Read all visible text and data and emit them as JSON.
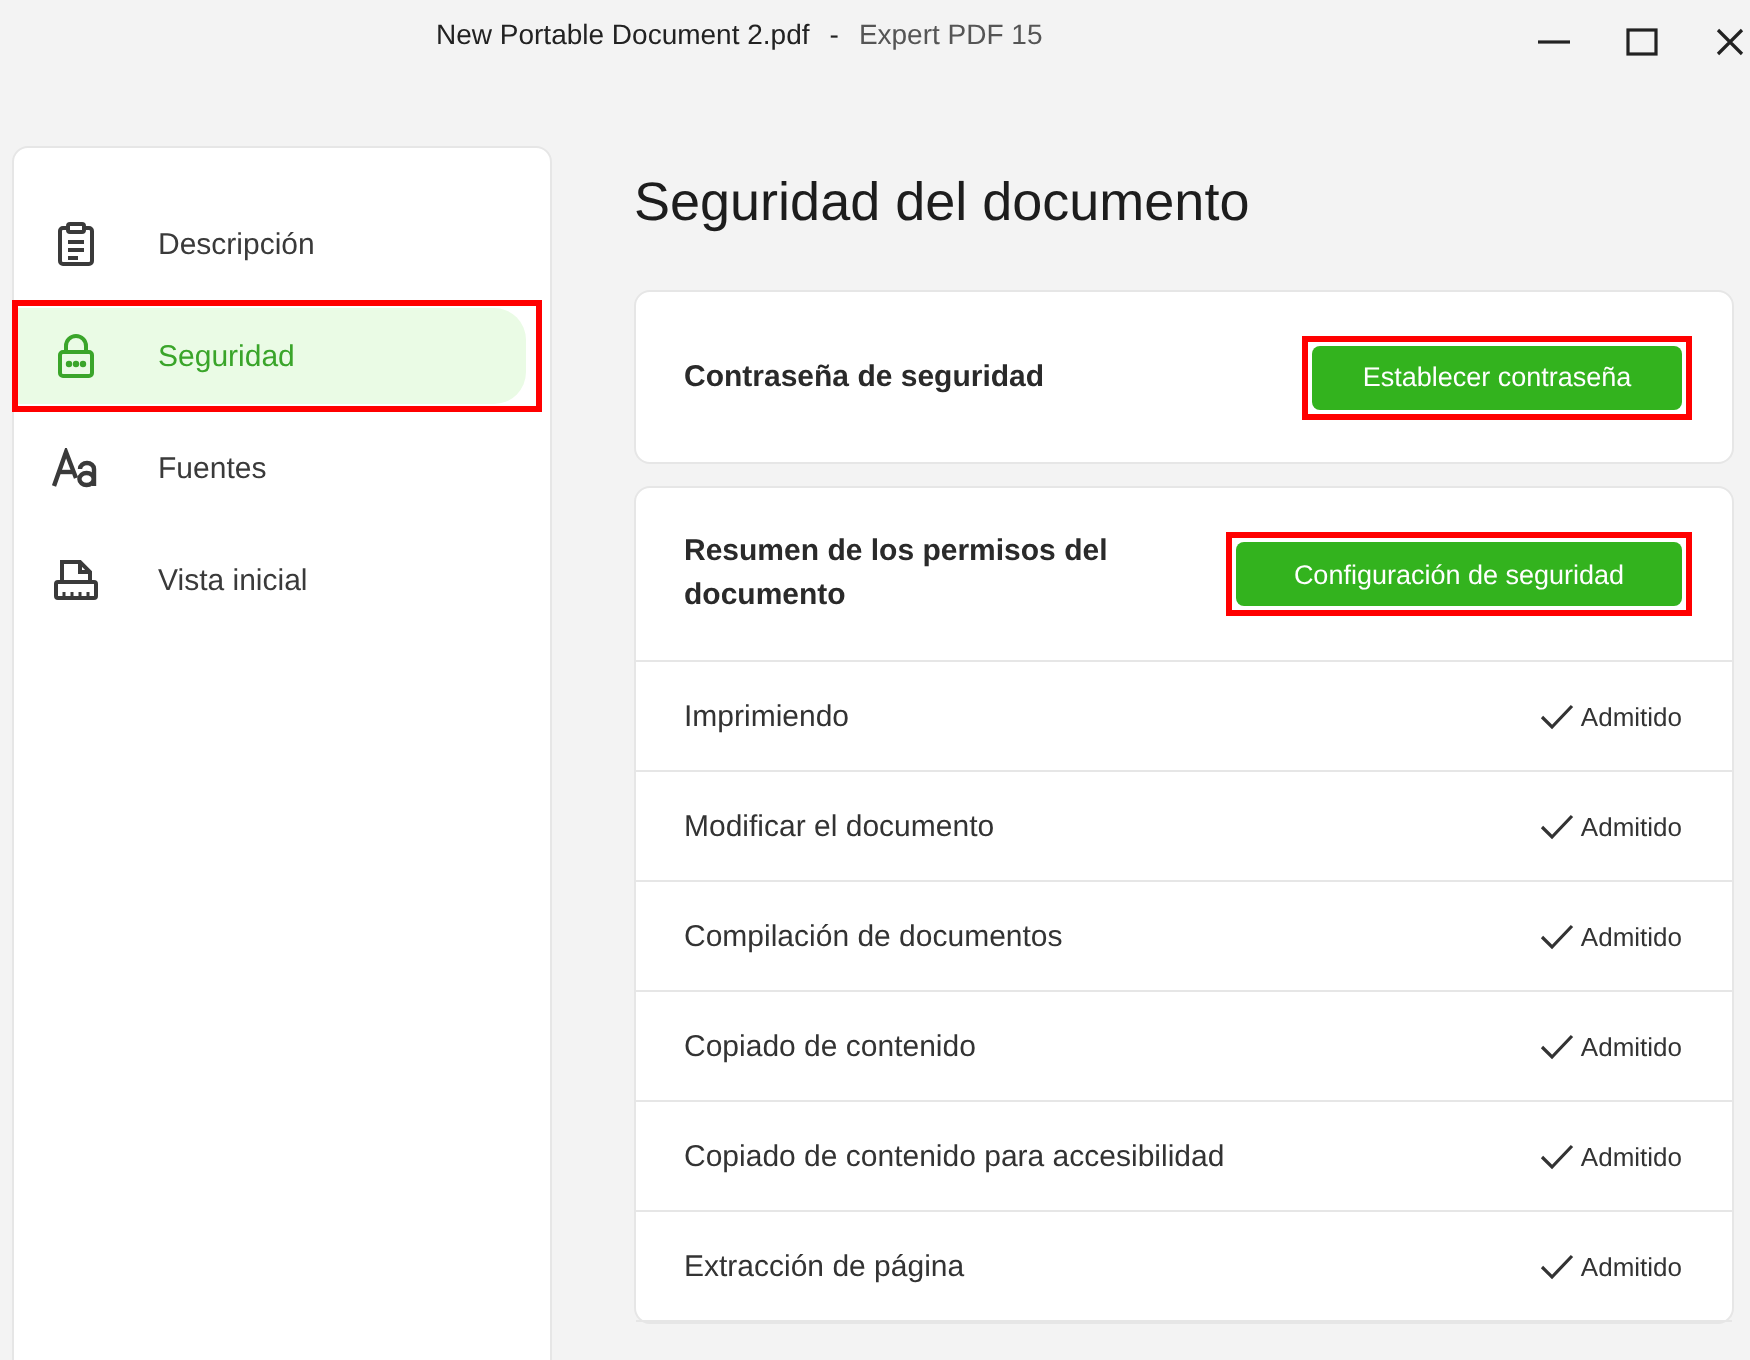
{
  "window": {
    "document": "New Portable Document 2.pdf",
    "separator": "-",
    "app": "Expert PDF 15"
  },
  "sidebar": {
    "items": [
      {
        "label": "Descripción",
        "selected": false,
        "highlighted": false
      },
      {
        "label": "Seguridad",
        "selected": true,
        "highlighted": true
      },
      {
        "label": "Fuentes",
        "selected": false,
        "highlighted": false
      },
      {
        "label": "Vista inicial",
        "selected": false,
        "highlighted": false
      }
    ]
  },
  "page_title": "Seguridad del documento",
  "password_card": {
    "label": "Contraseña de seguridad",
    "button": {
      "label": "Establecer contraseña",
      "highlighted": true
    }
  },
  "permissions_card": {
    "label": "Resumen de los permisos del documento",
    "button": {
      "label": "Configuración de seguridad",
      "highlighted": true
    },
    "rows": [
      {
        "name": "Imprimiendo",
        "status": "Admitido"
      },
      {
        "name": "Modificar el documento",
        "status": "Admitido"
      },
      {
        "name": "Compilación de documentos",
        "status": "Admitido"
      },
      {
        "name": "Copiado de contenido",
        "status": "Admitido"
      },
      {
        "name": "Copiado de contenido para accesibilidad",
        "status": "Admitido"
      },
      {
        "name": "Extracción de página",
        "status": "Admitido"
      }
    ]
  }
}
